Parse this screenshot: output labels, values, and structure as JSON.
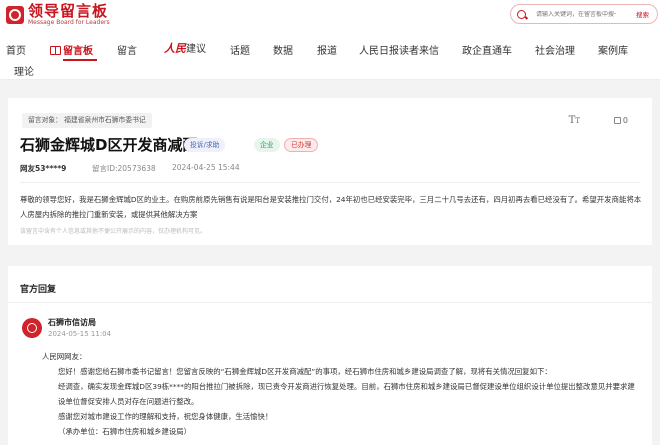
{
  "logo": {
    "cn": "领导留言板",
    "en": "Message Board for Leaders"
  },
  "search": {
    "placeholder": "请输入关键词，在留言板中搜一下",
    "button": "搜索"
  },
  "nav": [
    {
      "label": "首页"
    },
    {
      "label": "留言板",
      "active": true
    },
    {
      "label": "留言"
    },
    {
      "brand": "人民",
      "label": "建议"
    },
    {
      "label": "话题"
    },
    {
      "label": "数据"
    },
    {
      "label": "报道"
    },
    {
      "label": "人民日报读者来信"
    },
    {
      "label": "政企直通车"
    },
    {
      "label": "社会治理"
    },
    {
      "label": "案例库"
    },
    {
      "label": "理论"
    }
  ],
  "message": {
    "target_label": "留言对象：",
    "target": "福建省泉州市石狮市委书记",
    "title": "石狮金辉城D区开发商减配",
    "tags": [
      "投诉/求助",
      "企业",
      "已办理"
    ],
    "likes": "0",
    "user": "网友53****9",
    "id_label": "留言ID:",
    "id": "20573638",
    "time": "2024-04-25 15:44",
    "content": "尊敬的领导您好，我是石狮金辉城D区的业主。在购房前原先销售有说是阳台是安装推拉门交付，24年初也已经安装完毕，三月二十几号去还有，四月初再去看已经没有了。希望开发商能将本人房屋内拆除的推拉门重新安装，或提供其他解决方案",
    "disclaimer": "该留言中含有个人信息或其他不便公开展示的内容，仅办理机构可见。"
  },
  "reply": {
    "header": "官方回复",
    "org": "石狮市信访局",
    "date": "2024-05-15 11:04",
    "greeting": "人民网网友：",
    "paragraphs": [
      "您好！感谢您给石狮市委书记留言！您留言反映的“石狮金辉城D区开发商减配”的事项，经石狮市住房和城乡建设局调查了解，现将有关情况回复如下：",
      "经调查，确实发现金辉城D区39栋****的阳台推拉门被拆除，现已责令开发商进行恢复处理。目前，石狮市住房和城乡建设局已督促建设单位组织设计单位提出整改意见并要求建设单位督促安排人员对存在问题进行整改。",
      "感谢您对城市建设工作的理解和支持，祝您身体健康，生活愉快！"
    ],
    "signature": "（承办单位：石狮市住房和城乡建设局）"
  }
}
